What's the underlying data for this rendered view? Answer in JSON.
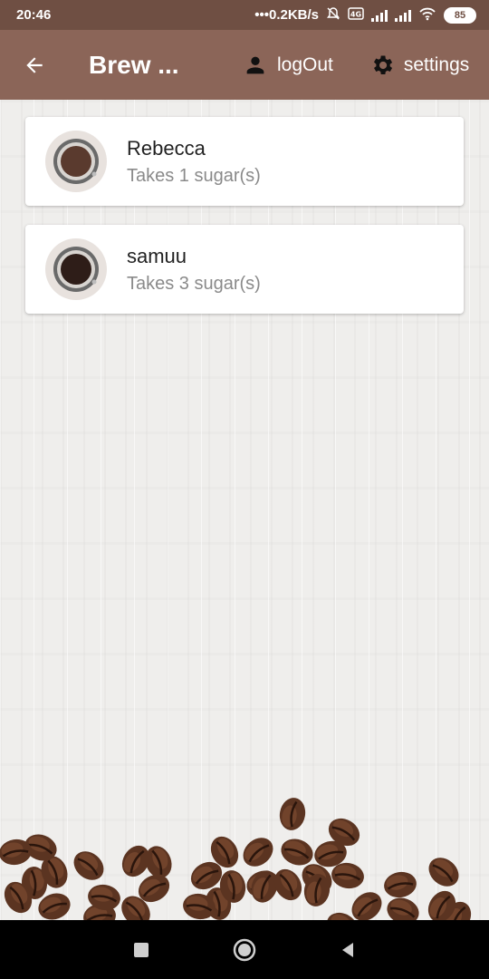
{
  "status_bar": {
    "time": "20:46",
    "speed": "•••0.2KB/s",
    "battery": "85"
  },
  "app_bar": {
    "title": "Brew ...",
    "logout_label": "logOut",
    "settings_label": "settings",
    "color": "#8b6558"
  },
  "drinkers": [
    {
      "name": "Rebecca",
      "subtitle": "Takes 1 sugar(s)",
      "coffee_color": "#5a3a2e"
    },
    {
      "name": "samuu",
      "subtitle": "Takes 3 sugar(s)",
      "coffee_color": "#2e1d18"
    }
  ],
  "nav_bar": {
    "icons": [
      "recents-icon",
      "home-icon",
      "back-icon"
    ]
  }
}
